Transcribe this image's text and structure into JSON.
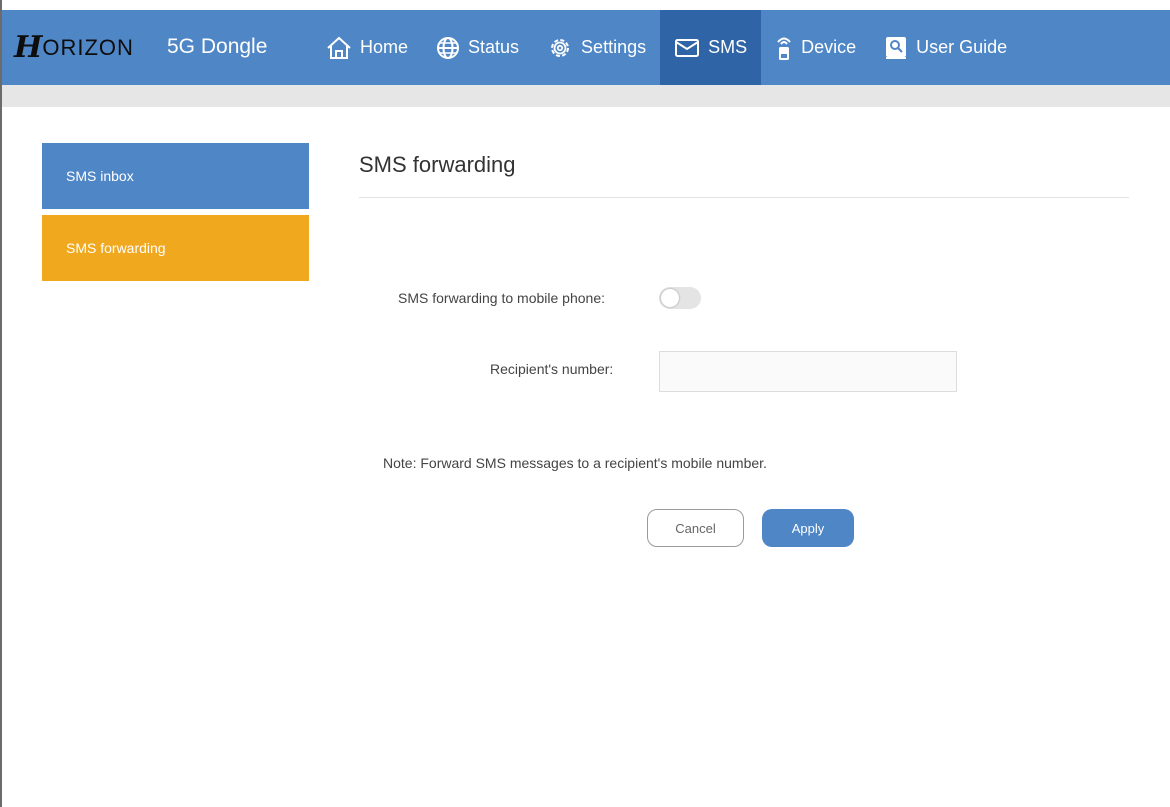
{
  "header": {
    "brand_logo": "H",
    "brand_name": "ORIZON",
    "product": "5G Dongle",
    "nav": [
      {
        "label": "Home",
        "icon": "home-icon"
      },
      {
        "label": "Status",
        "icon": "globe-icon"
      },
      {
        "label": "Settings",
        "icon": "gear-icon"
      },
      {
        "label": "SMS",
        "icon": "envelope-icon",
        "active": true
      },
      {
        "label": "Device",
        "icon": "router-icon"
      },
      {
        "label": "User Guide",
        "icon": "guide-icon"
      }
    ]
  },
  "sidebar": {
    "items": [
      {
        "label": "SMS inbox"
      },
      {
        "label": "SMS forwarding",
        "active": true
      }
    ]
  },
  "main": {
    "title": "SMS forwarding",
    "toggle_label": "SMS forwarding to mobile phone:",
    "toggle_on": false,
    "recipient_label": "Recipient's number:",
    "recipient_value": "",
    "note": "Note: Forward SMS messages to a recipient's mobile number.",
    "cancel_label": "Cancel",
    "apply_label": "Apply"
  },
  "colors": {
    "header_bg": "#4f86c6",
    "nav_active_bg": "#2f64a6",
    "sidebar_inbox_bg": "#4f86c6",
    "sidebar_active_bg": "#f0a81e"
  }
}
